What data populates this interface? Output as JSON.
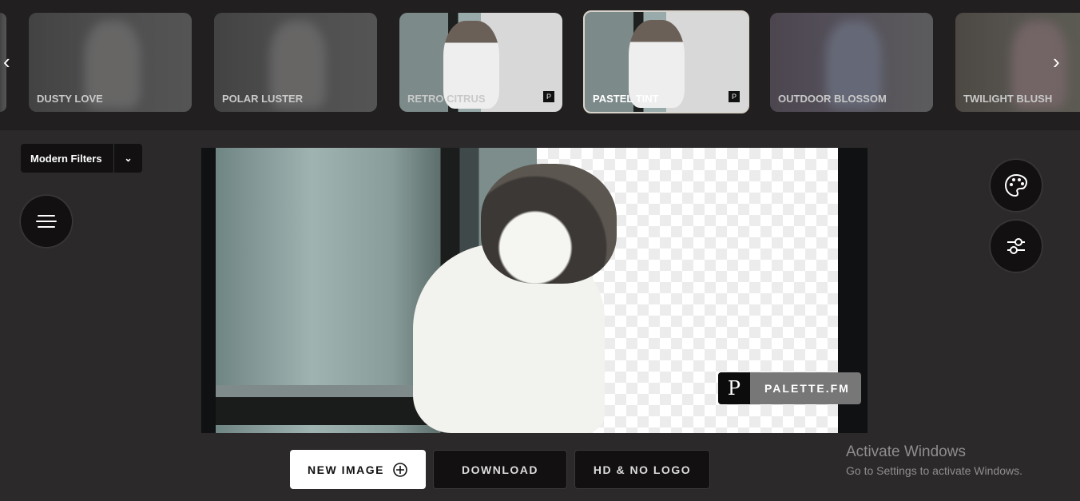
{
  "filters": [
    {
      "label": "Dusty Love",
      "selected": false
    },
    {
      "label": "Polar Luster",
      "selected": false
    },
    {
      "label": "Retro Citrus",
      "selected": false
    },
    {
      "label": "Pastel Tint",
      "selected": true
    },
    {
      "label": "Outdoor Blossom",
      "selected": false
    },
    {
      "label": "Twilight Blush",
      "selected": false
    }
  ],
  "thumb_watermark": "P",
  "nav": {
    "prev_icon": "chevron-left-icon",
    "next_icon": "chevron-right-icon"
  },
  "dropdown": {
    "value": "Modern Filters"
  },
  "watermark": {
    "letter": "P",
    "name": "PALETTE.FM"
  },
  "buttons": {
    "new_image": "NEW IMAGE",
    "download": "DOWNLOAD",
    "hd": "HD & NO LOGO"
  },
  "windows": {
    "title": "Activate Windows",
    "subtitle": "Go to Settings to activate Windows."
  }
}
